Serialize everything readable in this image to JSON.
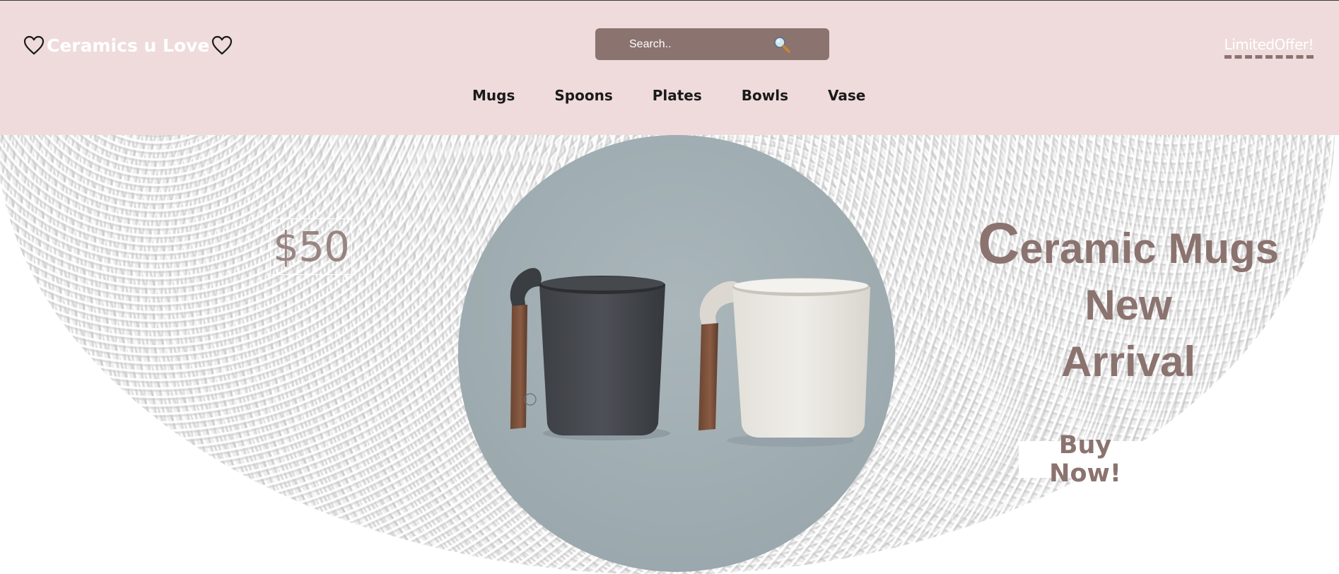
{
  "header": {
    "brand": "Ceramics u Love",
    "search_placeholder": "Search..",
    "offer_label": "LimitedOffer!",
    "nav": [
      "Mugs",
      "Spoons",
      "Plates",
      "Bowls",
      "Vase"
    ]
  },
  "hero": {
    "price": "$50",
    "headline": {
      "first_letter": "C",
      "rest_line1": "eramic Mugs",
      "line2": "New",
      "line3": "Arrival"
    },
    "cta": "Buy Now!"
  },
  "colors": {
    "header_bg": "#efdbdb",
    "accent": "#8b7370",
    "texture_bg": "#ededed",
    "mug_circle_bg": "#a3b0b4"
  },
  "icons": [
    "heart-icon",
    "search-icon"
  ]
}
